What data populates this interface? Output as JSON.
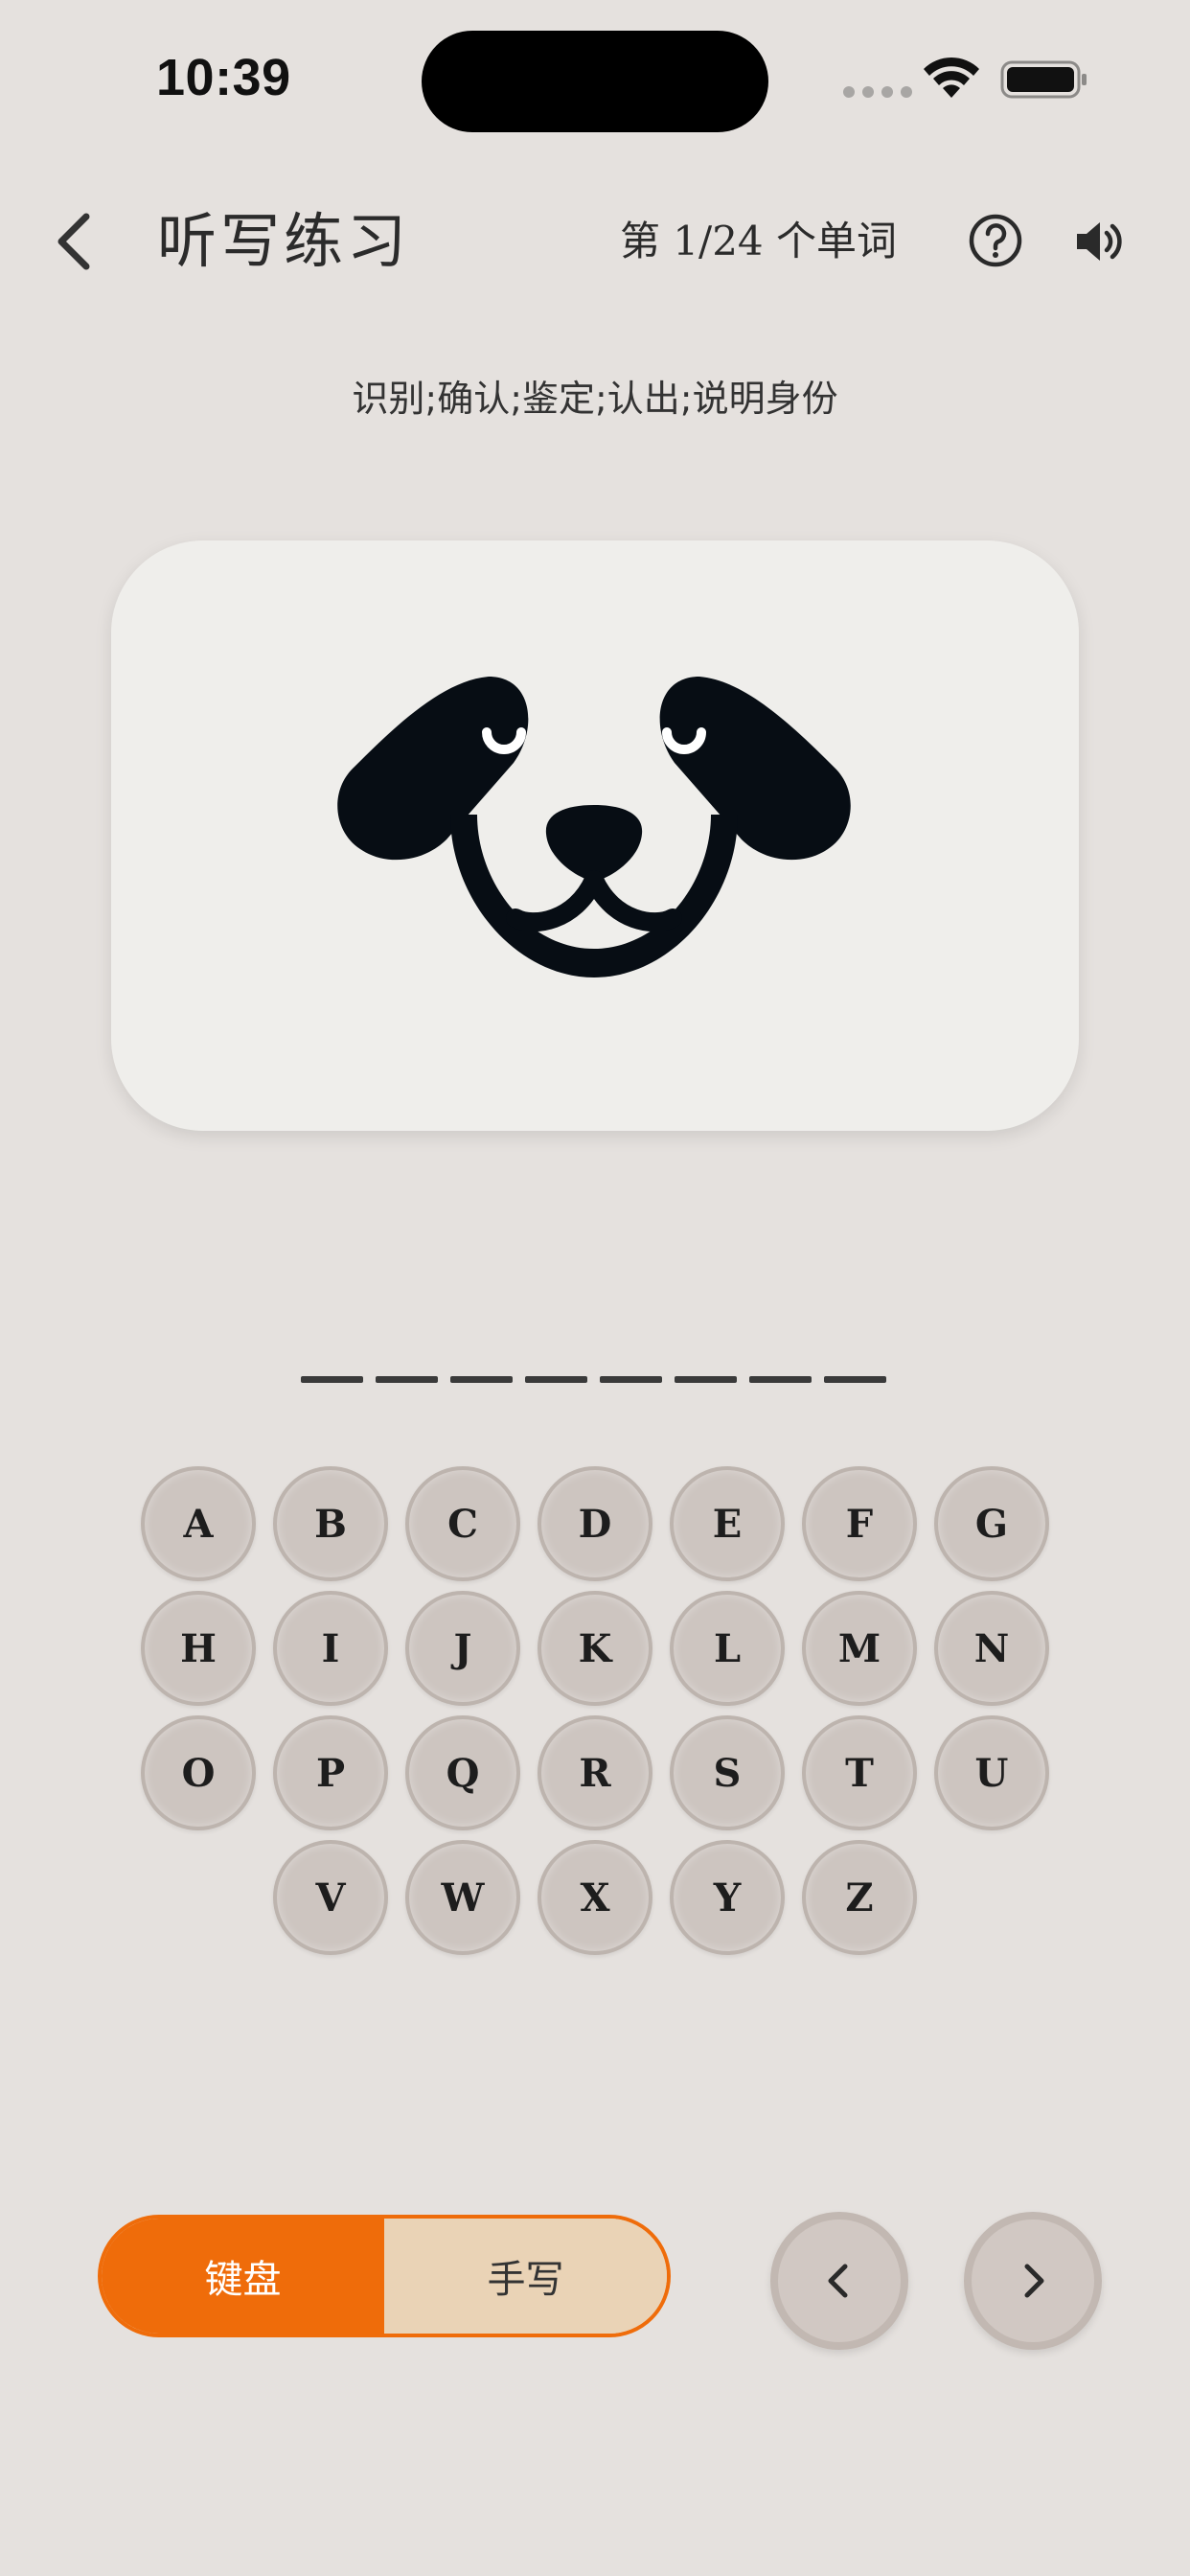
{
  "status_bar": {
    "time": "10:39",
    "icons": [
      "signal-dots-icon",
      "wifi-icon",
      "battery-icon"
    ]
  },
  "header": {
    "back_icon": "chevron-left-icon",
    "title": "听写练习",
    "progress": "第 1/24 个单词",
    "help_icon": "question-circle-icon",
    "speaker_icon": "speaker-icon"
  },
  "definition": "识别;确认;鉴定;认出;说明身份",
  "image": {
    "subject": "dog-face-icon"
  },
  "answer": {
    "slot_count": 8
  },
  "keyboard": {
    "rows": [
      [
        "A",
        "B",
        "C",
        "D",
        "E",
        "F",
        "G"
      ],
      [
        "H",
        "I",
        "J",
        "K",
        "L",
        "M",
        "N"
      ],
      [
        "O",
        "P",
        "Q",
        "R",
        "S",
        "T",
        "U"
      ],
      [
        "V",
        "W",
        "X",
        "Y",
        "Z"
      ]
    ]
  },
  "bottom": {
    "mode_keyboard": "键盘",
    "mode_handwrite": "手写",
    "selected_mode": "键盘",
    "prev_icon": "chevron-left-icon",
    "next_icon": "chevron-right-icon"
  },
  "colors": {
    "background": "#e5e1de",
    "accent": "#ef6c0a",
    "handwrite_bg": "#ead3b6",
    "key_fill": "#cdc5c0"
  }
}
